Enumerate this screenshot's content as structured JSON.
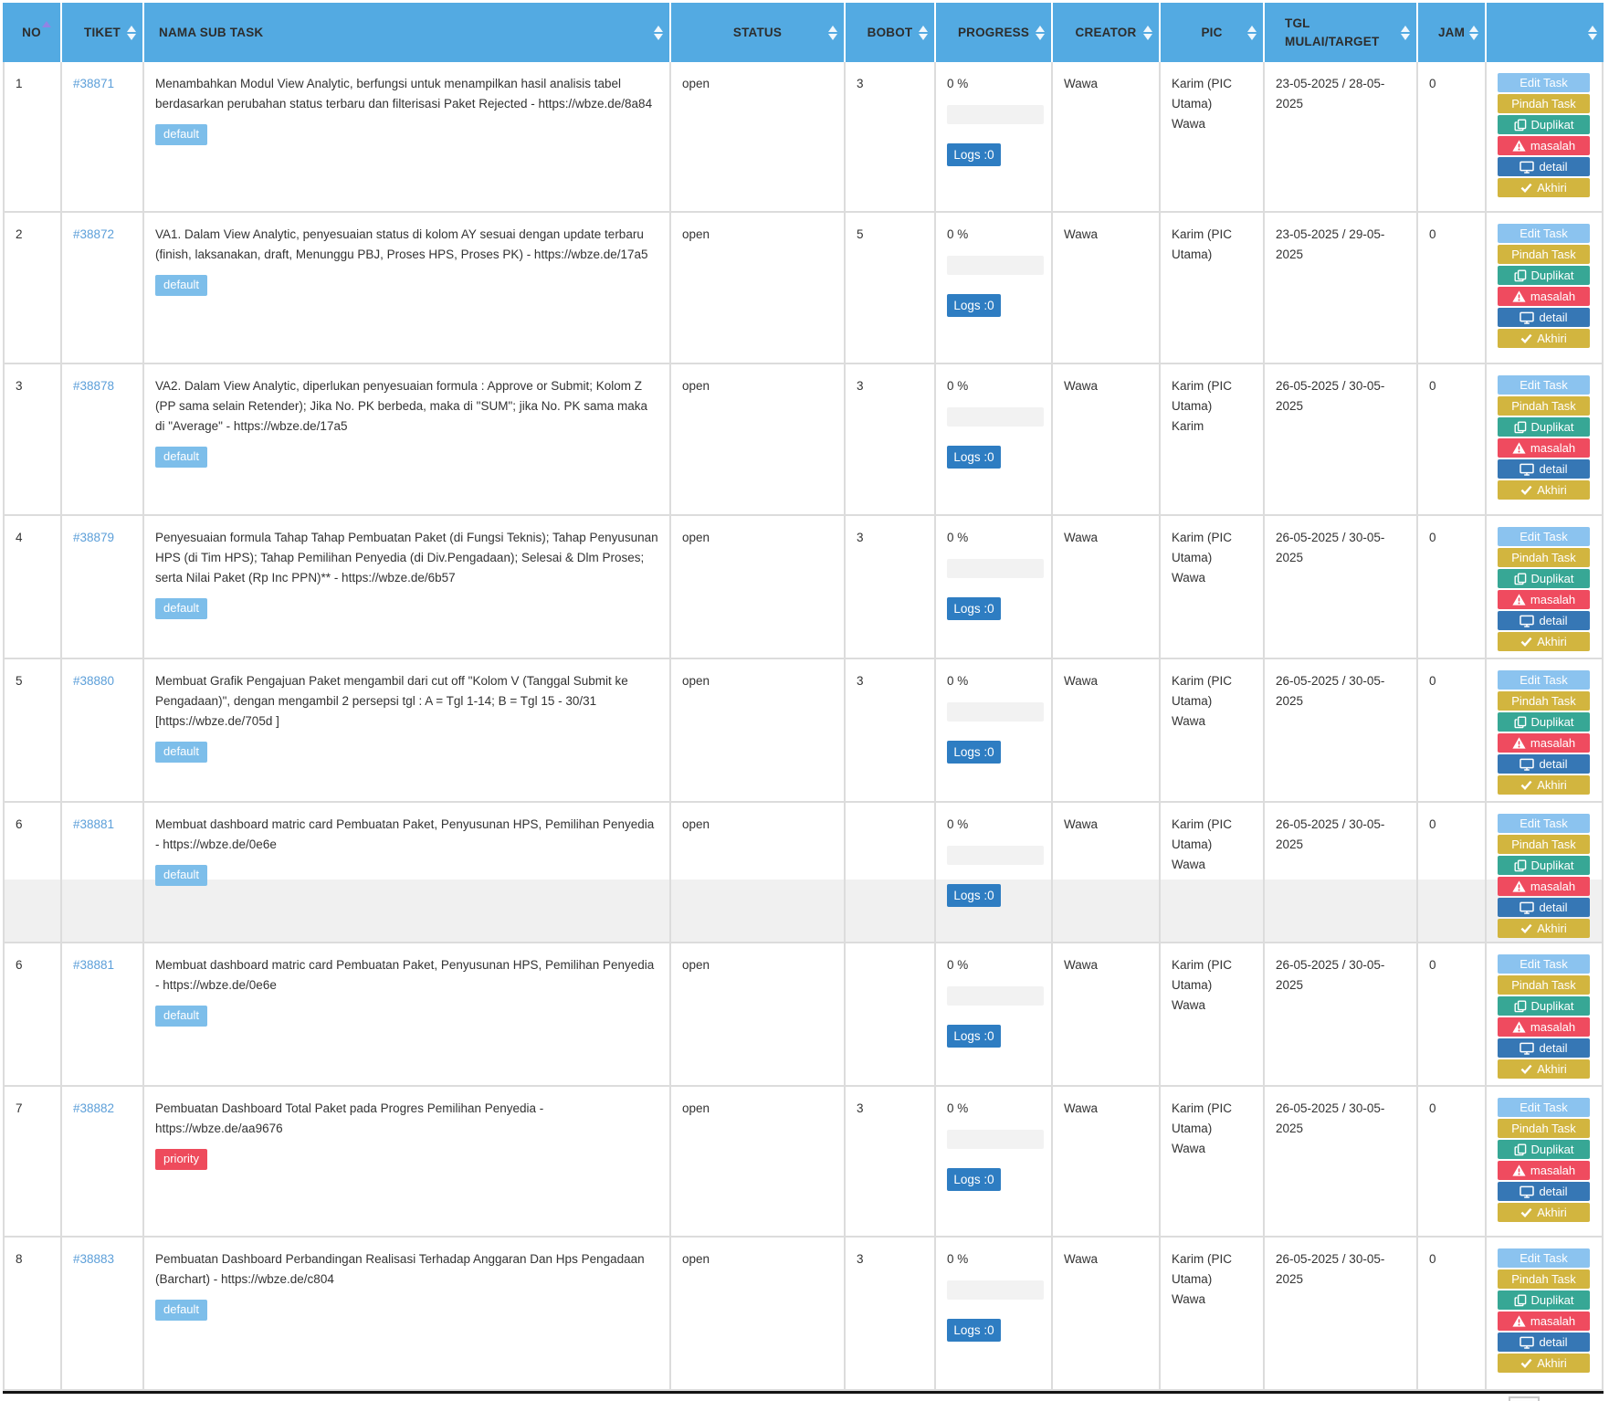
{
  "table": {
    "columns": [
      {
        "key": "no",
        "label": "NO",
        "sort": "asc"
      },
      {
        "key": "tiket",
        "label": "TIKET",
        "sort": "both"
      },
      {
        "key": "nama",
        "label": "NAMA SUB TASK",
        "sort": "both"
      },
      {
        "key": "status",
        "label": "STATUS",
        "sort": "both"
      },
      {
        "key": "bobot",
        "label": "BOBOT",
        "sort": "both"
      },
      {
        "key": "progress",
        "label": "PROGRESS",
        "sort": "both"
      },
      {
        "key": "creator",
        "label": "CREATOR",
        "sort": "both"
      },
      {
        "key": "pic",
        "label": "PIC",
        "sort": "both"
      },
      {
        "key": "tgl",
        "label": "TGL MULAI/TARGET",
        "sort": "both"
      },
      {
        "key": "jam",
        "label": "JAM",
        "sort": "both"
      },
      {
        "key": "actions",
        "label": "",
        "sort": "both"
      }
    ],
    "actions": [
      {
        "id": "edit",
        "label": "Edit Task",
        "icon": null
      },
      {
        "id": "pindah",
        "label": "Pindah Task",
        "icon": null
      },
      {
        "id": "duplikat",
        "label": "Duplikat",
        "icon": "copy"
      },
      {
        "id": "masalah",
        "label": "masalah",
        "icon": "warning"
      },
      {
        "id": "detail",
        "label": "detail",
        "icon": "monitor"
      },
      {
        "id": "akhiri",
        "label": "Akhiri",
        "icon": "check"
      }
    ],
    "rows": [
      {
        "no": "1",
        "tiket": "#38871",
        "task": "Menambahkan Modul View Analytic, berfungsi untuk menampilkan hasil analisis tabel berdasarkan perubahan status terbaru dan filterisasi Paket Rejected - https://wbze.de/8a84",
        "badge": "default",
        "badge_type": "default",
        "status": "open",
        "bobot": "3",
        "progress": "0 %",
        "logs": "Logs :0",
        "creator": "Wawa",
        "pic": "Karim (PIC Utama)\nWawa",
        "tgl": "23-05-2025 / 28-05-2025",
        "jam": "0"
      },
      {
        "no": "2",
        "tiket": "#38872",
        "task": "VA1. Dalam View Analytic, penyesuaian status di kolom AY sesuai dengan update terbaru (finish, laksanakan, draft, Menunggu PBJ, Proses HPS, Proses PK) - https://wbze.de/17a5",
        "badge": "default",
        "badge_type": "default",
        "status": "open",
        "bobot": "5",
        "progress": "0 %",
        "logs": "Logs :0",
        "creator": "Wawa",
        "pic": "Karim (PIC Utama)",
        "tgl": "23-05-2025 / 29-05-2025",
        "jam": "0"
      },
      {
        "no": "3",
        "tiket": "#38878",
        "task": "VA2. Dalam View Analytic, diperlukan penyesuaian formula : Approve or Submit; Kolom Z (PP sama selain Retender); Jika No. PK berbeda, maka di \"SUM\"; jika No. PK sama maka di \"Average\" - https://wbze.de/17a5",
        "badge": "default",
        "badge_type": "default",
        "status": "open",
        "bobot": "3",
        "progress": "0 %",
        "logs": "Logs :0",
        "creator": "Wawa",
        "pic": "Karim (PIC Utama) Karim",
        "tgl": "26-05-2025 / 30-05-2025",
        "jam": "0"
      },
      {
        "no": "4",
        "tiket": "#38879",
        "task": "Penyesuaian formula Tahap Tahap Pembuatan Paket (di Fungsi Teknis); Tahap Penyusunan HPS (di Tim HPS); Tahap Pemilihan Penyedia (di Div.Pengadaan); Selesai & Dlm Proses; serta Nilai Paket (Rp Inc PPN)** - https://wbze.de/6b57",
        "badge": "default",
        "badge_type": "default",
        "status": "open",
        "bobot": "3",
        "progress": "0 %",
        "logs": "Logs :0",
        "creator": "Wawa",
        "pic": "Karim (PIC Utama)\nWawa",
        "tgl": "26-05-2025 / 30-05-2025",
        "jam": "0"
      },
      {
        "no": "5",
        "tiket": "#38880",
        "task": "Membuat Grafik Pengajuan Paket mengambil dari cut off \"Kolom V (Tanggal Submit ke Pengadaan)\", dengan mengambil 2 persepsi tgl : A = Tgl 1-14; B = Tgl 15 - 30/31 [https://wbze.de/705d ]",
        "badge": "default",
        "badge_type": "default",
        "status": "open",
        "bobot": "3",
        "progress": "0 %",
        "logs": "Logs :0",
        "creator": "Wawa",
        "pic": "Karim (PIC Utama)\nWawa",
        "tgl": "26-05-2025 / 30-05-2025",
        "jam": "0"
      },
      {
        "no": "6",
        "tiket": "#38881",
        "task": "Membuat dashboard matric card Pembuatan Paket, Penyusunan HPS, Pemilihan Penyedia - https://wbze.de/0e6e",
        "badge": "default",
        "badge_type": "default",
        "status": "open",
        "bobot": "",
        "progress": "0 %",
        "logs": "Logs :0",
        "creator": "Wawa",
        "pic": "Karim (PIC Utama)\nWawa",
        "tgl": "26-05-2025 / 30-05-2025",
        "jam": "0"
      },
      {
        "no": "6",
        "tiket": "#38881",
        "task": "Membuat dashboard matric card Pembuatan Paket, Penyusunan HPS, Pemilihan Penyedia - https://wbze.de/0e6e",
        "badge": "default",
        "badge_type": "default",
        "status": "open",
        "bobot": "",
        "progress": "0 %",
        "logs": "Logs :0",
        "creator": "Wawa",
        "pic": "Karim (PIC Utama)\nWawa",
        "tgl": "26-05-2025 / 30-05-2025",
        "jam": "0"
      },
      {
        "no": "7",
        "tiket": "#38882",
        "task": "Pembuatan Dashboard Total Paket pada Progres Pemilihan Penyedia - https://wbze.de/aa9676",
        "badge": "priority",
        "badge_type": "priority",
        "status": "open",
        "bobot": "3",
        "progress": "0 %",
        "logs": "Logs :0",
        "creator": "Wawa",
        "pic": "Karim (PIC Utama)\nWawa",
        "tgl": "26-05-2025 / 30-05-2025",
        "jam": "0"
      },
      {
        "no": "8",
        "tiket": "#38883",
        "task": "Pembuatan Dashboard Perbandingan Realisasi Terhadap Anggaran Dan Hps Pengadaan (Barchart) - https://wbze.de/c804",
        "badge": "default",
        "badge_type": "default",
        "status": "open",
        "bobot": "3",
        "progress": "0 %",
        "logs": "Logs :0",
        "creator": "Wawa",
        "pic": "Karim (PIC Utama)\nWawa",
        "tgl": "26-05-2025 / 30-05-2025",
        "jam": "0"
      }
    ]
  },
  "colors": {
    "header_bg": "#53AAE2",
    "header_text": "#2D2D2D",
    "sort_arrow_active": "#9184E4",
    "link": "#5C9FD9",
    "body_text": "#333333",
    "badge_default": "#7DBEEA",
    "badge_priority": "#EE4B5C",
    "logs_button": "#2E7DC2",
    "progress_track": "#F2F2F2",
    "row_stripe_gray": "#F0F0F0",
    "cell_border": "#DCDCDC",
    "bottom_line": "#141414",
    "edit_task_button": "#8BC3EF",
    "pindah_task_button": "#D2B53F",
    "duplikat_button": "#37A795",
    "masalah_button": "#EF4B5F",
    "detail_button": "#3677B5",
    "akhiri_button": "#D2B53F"
  }
}
